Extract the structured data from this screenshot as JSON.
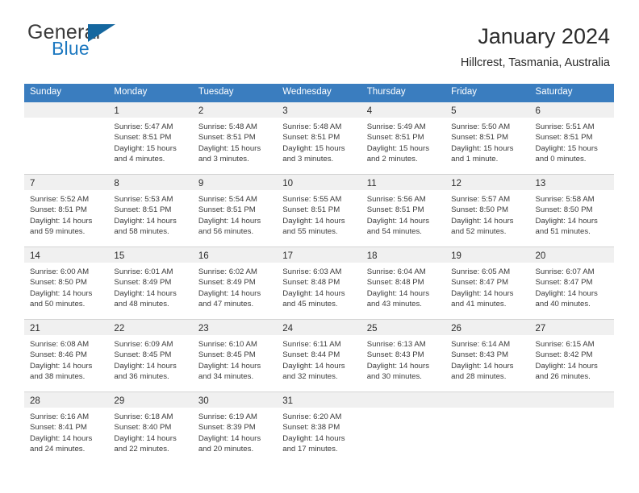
{
  "brand": {
    "word1": "General",
    "word2": "Blue",
    "triangle": "triangle-logo"
  },
  "header": {
    "title": "January 2024",
    "location": "Hillcrest, Tasmania, Australia"
  },
  "calendar": {
    "weekday_headers": [
      "Sunday",
      "Monday",
      "Tuesday",
      "Wednesday",
      "Thursday",
      "Friday",
      "Saturday"
    ],
    "accent_color": "#3a7dbf",
    "daynum_band_color": "#f0f0f0",
    "weeks": [
      [
        {
          "day": "",
          "sunrise": "",
          "sunset": "",
          "daylight1": "",
          "daylight2": ""
        },
        {
          "day": "1",
          "sunrise": "Sunrise: 5:47 AM",
          "sunset": "Sunset: 8:51 PM",
          "daylight1": "Daylight: 15 hours",
          "daylight2": "and 4 minutes."
        },
        {
          "day": "2",
          "sunrise": "Sunrise: 5:48 AM",
          "sunset": "Sunset: 8:51 PM",
          "daylight1": "Daylight: 15 hours",
          "daylight2": "and 3 minutes."
        },
        {
          "day": "3",
          "sunrise": "Sunrise: 5:48 AM",
          "sunset": "Sunset: 8:51 PM",
          "daylight1": "Daylight: 15 hours",
          "daylight2": "and 3 minutes."
        },
        {
          "day": "4",
          "sunrise": "Sunrise: 5:49 AM",
          "sunset": "Sunset: 8:51 PM",
          "daylight1": "Daylight: 15 hours",
          "daylight2": "and 2 minutes."
        },
        {
          "day": "5",
          "sunrise": "Sunrise: 5:50 AM",
          "sunset": "Sunset: 8:51 PM",
          "daylight1": "Daylight: 15 hours",
          "daylight2": "and 1 minute."
        },
        {
          "day": "6",
          "sunrise": "Sunrise: 5:51 AM",
          "sunset": "Sunset: 8:51 PM",
          "daylight1": "Daylight: 15 hours",
          "daylight2": "and 0 minutes."
        }
      ],
      [
        {
          "day": "7",
          "sunrise": "Sunrise: 5:52 AM",
          "sunset": "Sunset: 8:51 PM",
          "daylight1": "Daylight: 14 hours",
          "daylight2": "and 59 minutes."
        },
        {
          "day": "8",
          "sunrise": "Sunrise: 5:53 AM",
          "sunset": "Sunset: 8:51 PM",
          "daylight1": "Daylight: 14 hours",
          "daylight2": "and 58 minutes."
        },
        {
          "day": "9",
          "sunrise": "Sunrise: 5:54 AM",
          "sunset": "Sunset: 8:51 PM",
          "daylight1": "Daylight: 14 hours",
          "daylight2": "and 56 minutes."
        },
        {
          "day": "10",
          "sunrise": "Sunrise: 5:55 AM",
          "sunset": "Sunset: 8:51 PM",
          "daylight1": "Daylight: 14 hours",
          "daylight2": "and 55 minutes."
        },
        {
          "day": "11",
          "sunrise": "Sunrise: 5:56 AM",
          "sunset": "Sunset: 8:51 PM",
          "daylight1": "Daylight: 14 hours",
          "daylight2": "and 54 minutes."
        },
        {
          "day": "12",
          "sunrise": "Sunrise: 5:57 AM",
          "sunset": "Sunset: 8:50 PM",
          "daylight1": "Daylight: 14 hours",
          "daylight2": "and 52 minutes."
        },
        {
          "day": "13",
          "sunrise": "Sunrise: 5:58 AM",
          "sunset": "Sunset: 8:50 PM",
          "daylight1": "Daylight: 14 hours",
          "daylight2": "and 51 minutes."
        }
      ],
      [
        {
          "day": "14",
          "sunrise": "Sunrise: 6:00 AM",
          "sunset": "Sunset: 8:50 PM",
          "daylight1": "Daylight: 14 hours",
          "daylight2": "and 50 minutes."
        },
        {
          "day": "15",
          "sunrise": "Sunrise: 6:01 AM",
          "sunset": "Sunset: 8:49 PM",
          "daylight1": "Daylight: 14 hours",
          "daylight2": "and 48 minutes."
        },
        {
          "day": "16",
          "sunrise": "Sunrise: 6:02 AM",
          "sunset": "Sunset: 8:49 PM",
          "daylight1": "Daylight: 14 hours",
          "daylight2": "and 47 minutes."
        },
        {
          "day": "17",
          "sunrise": "Sunrise: 6:03 AM",
          "sunset": "Sunset: 8:48 PM",
          "daylight1": "Daylight: 14 hours",
          "daylight2": "and 45 minutes."
        },
        {
          "day": "18",
          "sunrise": "Sunrise: 6:04 AM",
          "sunset": "Sunset: 8:48 PM",
          "daylight1": "Daylight: 14 hours",
          "daylight2": "and 43 minutes."
        },
        {
          "day": "19",
          "sunrise": "Sunrise: 6:05 AM",
          "sunset": "Sunset: 8:47 PM",
          "daylight1": "Daylight: 14 hours",
          "daylight2": "and 41 minutes."
        },
        {
          "day": "20",
          "sunrise": "Sunrise: 6:07 AM",
          "sunset": "Sunset: 8:47 PM",
          "daylight1": "Daylight: 14 hours",
          "daylight2": "and 40 minutes."
        }
      ],
      [
        {
          "day": "21",
          "sunrise": "Sunrise: 6:08 AM",
          "sunset": "Sunset: 8:46 PM",
          "daylight1": "Daylight: 14 hours",
          "daylight2": "and 38 minutes."
        },
        {
          "day": "22",
          "sunrise": "Sunrise: 6:09 AM",
          "sunset": "Sunset: 8:45 PM",
          "daylight1": "Daylight: 14 hours",
          "daylight2": "and 36 minutes."
        },
        {
          "day": "23",
          "sunrise": "Sunrise: 6:10 AM",
          "sunset": "Sunset: 8:45 PM",
          "daylight1": "Daylight: 14 hours",
          "daylight2": "and 34 minutes."
        },
        {
          "day": "24",
          "sunrise": "Sunrise: 6:11 AM",
          "sunset": "Sunset: 8:44 PM",
          "daylight1": "Daylight: 14 hours",
          "daylight2": "and 32 minutes."
        },
        {
          "day": "25",
          "sunrise": "Sunrise: 6:13 AM",
          "sunset": "Sunset: 8:43 PM",
          "daylight1": "Daylight: 14 hours",
          "daylight2": "and 30 minutes."
        },
        {
          "day": "26",
          "sunrise": "Sunrise: 6:14 AM",
          "sunset": "Sunset: 8:43 PM",
          "daylight1": "Daylight: 14 hours",
          "daylight2": "and 28 minutes."
        },
        {
          "day": "27",
          "sunrise": "Sunrise: 6:15 AM",
          "sunset": "Sunset: 8:42 PM",
          "daylight1": "Daylight: 14 hours",
          "daylight2": "and 26 minutes."
        }
      ],
      [
        {
          "day": "28",
          "sunrise": "Sunrise: 6:16 AM",
          "sunset": "Sunset: 8:41 PM",
          "daylight1": "Daylight: 14 hours",
          "daylight2": "and 24 minutes."
        },
        {
          "day": "29",
          "sunrise": "Sunrise: 6:18 AM",
          "sunset": "Sunset: 8:40 PM",
          "daylight1": "Daylight: 14 hours",
          "daylight2": "and 22 minutes."
        },
        {
          "day": "30",
          "sunrise": "Sunrise: 6:19 AM",
          "sunset": "Sunset: 8:39 PM",
          "daylight1": "Daylight: 14 hours",
          "daylight2": "and 20 minutes."
        },
        {
          "day": "31",
          "sunrise": "Sunrise: 6:20 AM",
          "sunset": "Sunset: 8:38 PM",
          "daylight1": "Daylight: 14 hours",
          "daylight2": "and 17 minutes."
        },
        {
          "day": "",
          "sunrise": "",
          "sunset": "",
          "daylight1": "",
          "daylight2": ""
        },
        {
          "day": "",
          "sunrise": "",
          "sunset": "",
          "daylight1": "",
          "daylight2": ""
        },
        {
          "day": "",
          "sunrise": "",
          "sunset": "",
          "daylight1": "",
          "daylight2": ""
        }
      ]
    ]
  }
}
